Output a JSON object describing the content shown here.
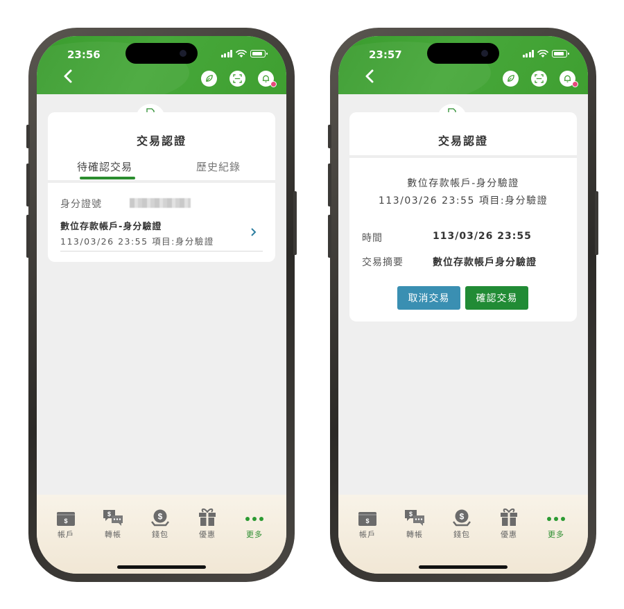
{
  "left": {
    "status": {
      "time": "23:56"
    },
    "card": {
      "title": "交易認證",
      "tabs": [
        {
          "label": "待確認交易",
          "active": true
        },
        {
          "label": "歷史紀錄",
          "active": false
        }
      ],
      "id_label": "身分證號",
      "transaction": {
        "title": "數位存款帳戶-身分驗證",
        "subtitle": "113/03/26 23:55 項目:身分驗證"
      }
    }
  },
  "right": {
    "status": {
      "time": "23:57"
    },
    "card": {
      "title": "交易認證",
      "detail_line1": "數位存款帳戶-身分驗證",
      "detail_line2": "113/03/26 23:55 項目:身分驗證",
      "time_label": "時間",
      "time_value": "113/03/26 23:55",
      "summary_label": "交易摘要",
      "summary_value": "數位存款帳戶身分驗證",
      "cancel_button": "取消交易",
      "confirm_button": "確認交易"
    }
  },
  "nav": [
    {
      "label": "帳戶",
      "icon": "account-icon"
    },
    {
      "label": "轉帳",
      "icon": "transfer-icon"
    },
    {
      "label": "錢包",
      "icon": "wallet-icon"
    },
    {
      "label": "優惠",
      "icon": "gift-icon"
    },
    {
      "label": "更多",
      "icon": "more-icon",
      "active": true
    }
  ],
  "header_icons": [
    "leaf-icon",
    "scan-icon",
    "bell-icon"
  ],
  "colors": {
    "brand_green": "#3f9f31",
    "cancel": "#3a8fb2",
    "confirm": "#218b35",
    "notify": "#e6497b"
  }
}
